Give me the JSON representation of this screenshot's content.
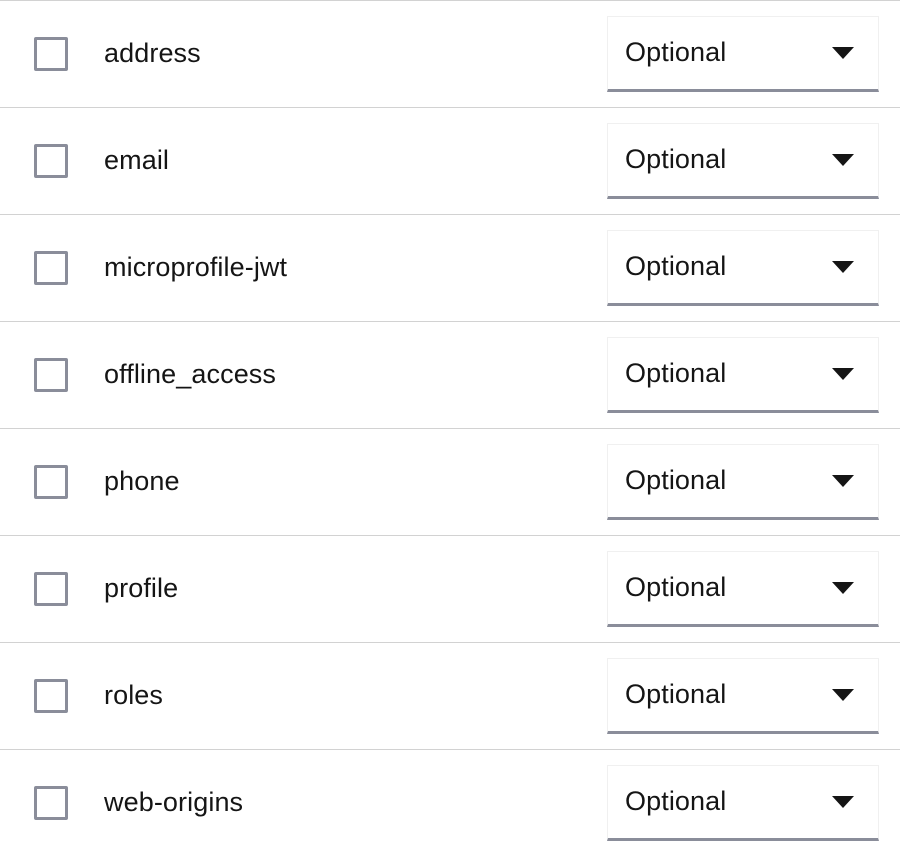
{
  "colors": {
    "row_separator": "#d2d2d2",
    "checkbox_border": "#8a8d9a",
    "select_border_bottom": "#8a8d9a",
    "select_border_side": "#f0f0f0",
    "text": "#151515",
    "background": "#ffffff"
  },
  "icons": {
    "caret": "chevron-down-icon",
    "checkbox": "checkbox-icon"
  },
  "table": {
    "rows": [
      {
        "name": "address",
        "checked": false,
        "assigned_type": "Optional"
      },
      {
        "name": "email",
        "checked": false,
        "assigned_type": "Optional"
      },
      {
        "name": "microprofile-jwt",
        "checked": false,
        "assigned_type": "Optional"
      },
      {
        "name": "offline_access",
        "checked": false,
        "assigned_type": "Optional"
      },
      {
        "name": "phone",
        "checked": false,
        "assigned_type": "Optional"
      },
      {
        "name": "profile",
        "checked": false,
        "assigned_type": "Optional"
      },
      {
        "name": "roles",
        "checked": false,
        "assigned_type": "Optional"
      },
      {
        "name": "web-origins",
        "checked": false,
        "assigned_type": "Optional"
      }
    ]
  }
}
